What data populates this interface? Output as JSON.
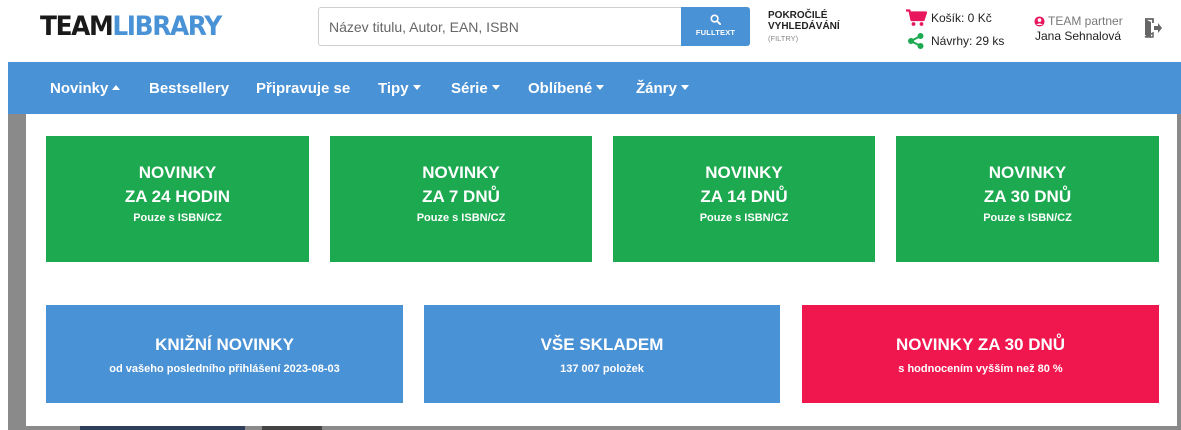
{
  "header": {
    "logo_team": "TEAM",
    "logo_library": "LIBRARY",
    "search_placeholder": "Název titulu, Autor, EAN, ISBN",
    "search_button_label": "FULLTEXT",
    "advanced_line1": "POKROČILÉ",
    "advanced_line2": "VYHLEDÁVÁNÍ",
    "advanced_filters": "(FILTRY)",
    "cart_label": "Košík: 0 Kč",
    "suggestions_label": "Návrhy: 29 ks",
    "partner_role": "TEAM partner",
    "user_name": "Jana Sehnalová"
  },
  "nav": {
    "items": [
      {
        "label": "Novinky",
        "caret": "up"
      },
      {
        "label": "Bestsellery",
        "caret": ""
      },
      {
        "label": "Připravuje se",
        "caret": ""
      },
      {
        "label": "Tipy",
        "caret": "down"
      },
      {
        "label": "Série",
        "caret": "down"
      },
      {
        "label": "Oblíbené",
        "caret": "down"
      },
      {
        "label": "Žánry",
        "caret": "down"
      }
    ]
  },
  "tiles_top": [
    {
      "line1": "NOVINKY",
      "line2": "ZA 24 HODIN",
      "sub": "Pouze s ISBN/CZ"
    },
    {
      "line1": "NOVINKY",
      "line2": "ZA 7 DNŮ",
      "sub": "Pouze s ISBN/CZ"
    },
    {
      "line1": "NOVINKY",
      "line2": "ZA 14 DNŮ",
      "sub": "Pouze s ISBN/CZ"
    },
    {
      "line1": "NOVINKY",
      "line2": "ZA 30 DNŮ",
      "sub": "Pouze s ISBN/CZ"
    }
  ],
  "tiles_bottom": [
    {
      "title": "KNIŽNÍ NOVINKY",
      "sub": "od vašeho posledního přihlášení 2023-08-03"
    },
    {
      "title": "VŠE SKLADEM",
      "sub": "137 007 položek"
    },
    {
      "title": "NOVINKY ZA 30 DNŮ",
      "sub": "s hodnocením vyšším než 80 %"
    }
  ],
  "colors": {
    "brand_blue": "#4a92d6",
    "green": "#1ca94f",
    "pink": "#f0174f",
    "cart_icon": "#e8175d",
    "share_icon": "#1ca94f"
  },
  "icons": {
    "search": "search-icon",
    "cart": "cart-icon",
    "share": "share-icon",
    "user": "user-icon",
    "logout": "logout-icon"
  }
}
